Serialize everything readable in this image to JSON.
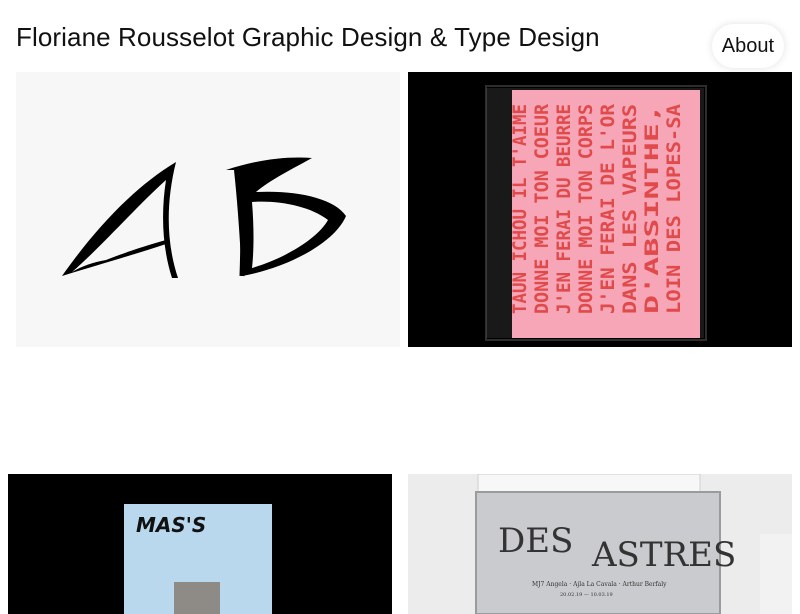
{
  "header": {
    "title": "Floriane Rousselot Graphic Design & Type Design",
    "about_label": "About"
  },
  "colors": {
    "background": "#ffffff",
    "poster_pink": "#f7a6b8",
    "poster_red_text": "#e04a4a",
    "mass_blue": "#b9d8ee",
    "astres_panel": "#c9cbce"
  },
  "projects": [
    {
      "kind": "type-specimen",
      "glyphs": "AB"
    },
    {
      "kind": "pink-poster",
      "lines": [
        "TAUN ICHOU IL T'AIME",
        "DONNE MOI TON COEUR",
        "J'EN FERAI DU BEURRE",
        "DONNE MOI TON CORPS",
        "J'EN FERAI DE L'OR",
        "DANS LES VAPEURS",
        "D'ABSINTHE,",
        "LOIN DES LOPES-SA"
      ]
    },
    {
      "kind": "magazine",
      "cover_title": "MAS'S"
    },
    {
      "kind": "exhibition-poster",
      "title_left": "DES",
      "title_right": "ASTRES",
      "credits": "MJ7 Angela · Ajla La Cavala · Arthur Berfaly",
      "dates": "20.02.19 — 10.03.19"
    }
  ]
}
